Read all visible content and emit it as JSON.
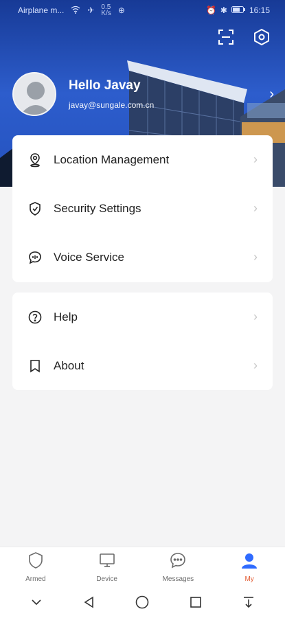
{
  "status": {
    "carrier": "Airplane m...",
    "speed_top": "0.5",
    "speed_bottom": "K/s",
    "time": "16:15"
  },
  "header": {
    "greeting": "Hello Javay",
    "email": "javay@sungale.com.cn"
  },
  "menu_primary": [
    {
      "label": "Location Management"
    },
    {
      "label": "Security Settings"
    },
    {
      "label": "Voice Service"
    }
  ],
  "menu_secondary": [
    {
      "label": "Help"
    },
    {
      "label": "About"
    }
  ],
  "tabs": [
    {
      "label": "Armed"
    },
    {
      "label": "Device"
    },
    {
      "label": "Messages"
    },
    {
      "label": "My"
    }
  ],
  "colors": {
    "accent": "#e35b32",
    "active_tab_icon": "#2f6bff",
    "hero_blue": "#2a57c2"
  },
  "icons": {
    "scan": "scan-icon",
    "settings": "hexagon-gear-icon",
    "location": "location-pin-icon",
    "security": "shield-check-icon",
    "voice": "chat-bubble-icon",
    "help": "question-circle-icon",
    "about": "bookmark-icon"
  }
}
